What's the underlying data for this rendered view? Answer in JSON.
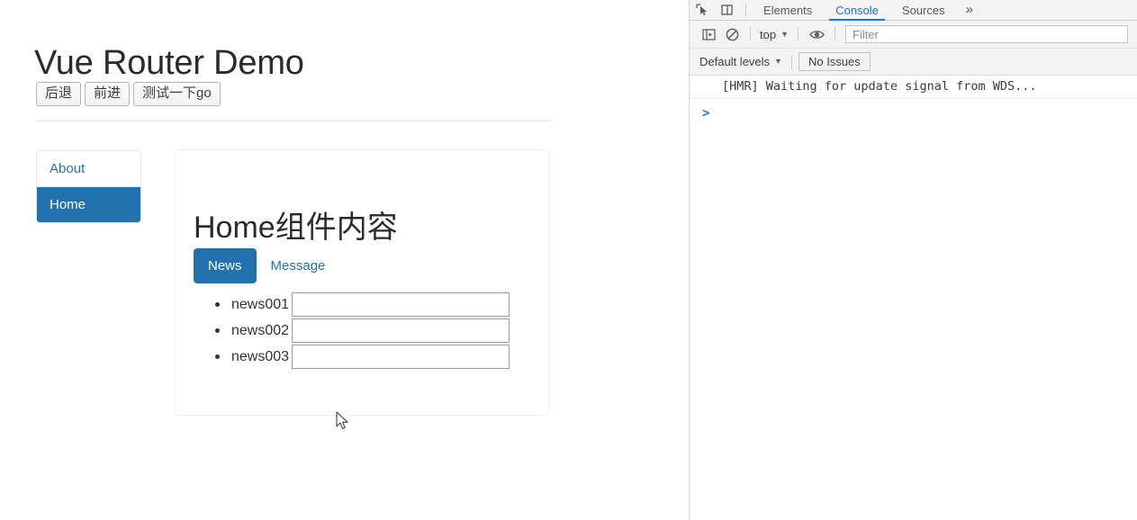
{
  "page": {
    "title": "Vue Router Demo",
    "nav_buttons": [
      {
        "label": "后退",
        "name": "back-button"
      },
      {
        "label": "前进",
        "name": "forward-button"
      },
      {
        "label": "测试一下go",
        "name": "test-go-button"
      }
    ],
    "sidebar": {
      "items": [
        {
          "label": "About",
          "active": false
        },
        {
          "label": "Home",
          "active": true
        }
      ]
    },
    "content": {
      "heading": "Home组件内容",
      "tabs": [
        {
          "label": "News",
          "active": true
        },
        {
          "label": "Message",
          "active": false
        }
      ],
      "news_items": [
        {
          "label": "news001",
          "value": ""
        },
        {
          "label": "news002",
          "value": ""
        },
        {
          "label": "news003",
          "value": ""
        }
      ]
    },
    "colors": {
      "accent": "#2272b0",
      "link": "#2272b0",
      "text": "#2b2b2b"
    }
  },
  "devtools": {
    "tabs": [
      {
        "label": "Elements",
        "active": false
      },
      {
        "label": "Console",
        "active": true
      },
      {
        "label": "Sources",
        "active": false
      }
    ],
    "more_tabs_glyph": "»",
    "toolbar": {
      "context_label": "top",
      "filter_placeholder": "Filter",
      "filter_value": ""
    },
    "levels": {
      "levels_label": "Default levels",
      "issues_label": "No Issues"
    },
    "console": {
      "messages": [
        "[HMR] Waiting for update signal from WDS..."
      ],
      "prompt_glyph": ">"
    },
    "colors": {
      "active_tab": "#1a73e8",
      "chrome_bg": "#f3f3f3"
    }
  }
}
